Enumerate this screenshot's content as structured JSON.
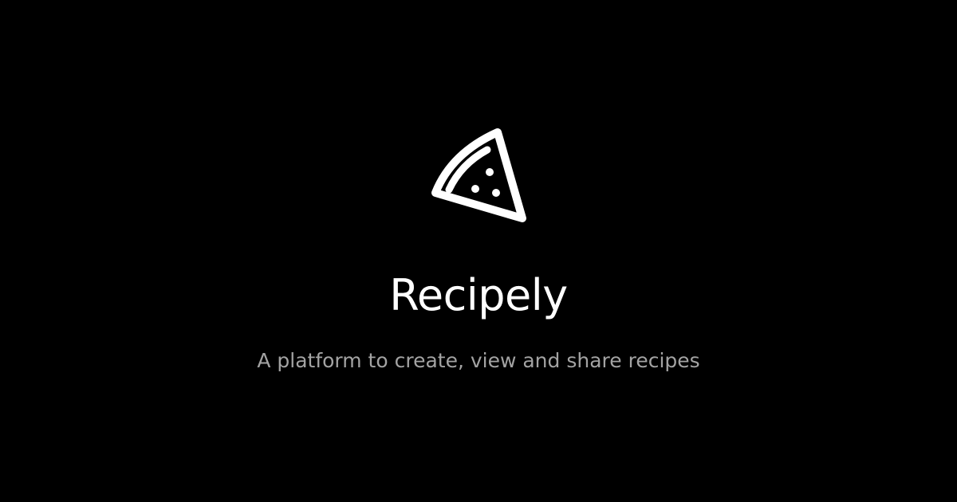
{
  "brand": {
    "logo_icon": "pizza-slice-icon",
    "name": "Recipely",
    "tagline": "A platform to create, view and share recipes"
  },
  "colors": {
    "background": "#000000",
    "title": "#ffffff",
    "tagline": "#a3a3a3",
    "icon": "#ffffff"
  }
}
